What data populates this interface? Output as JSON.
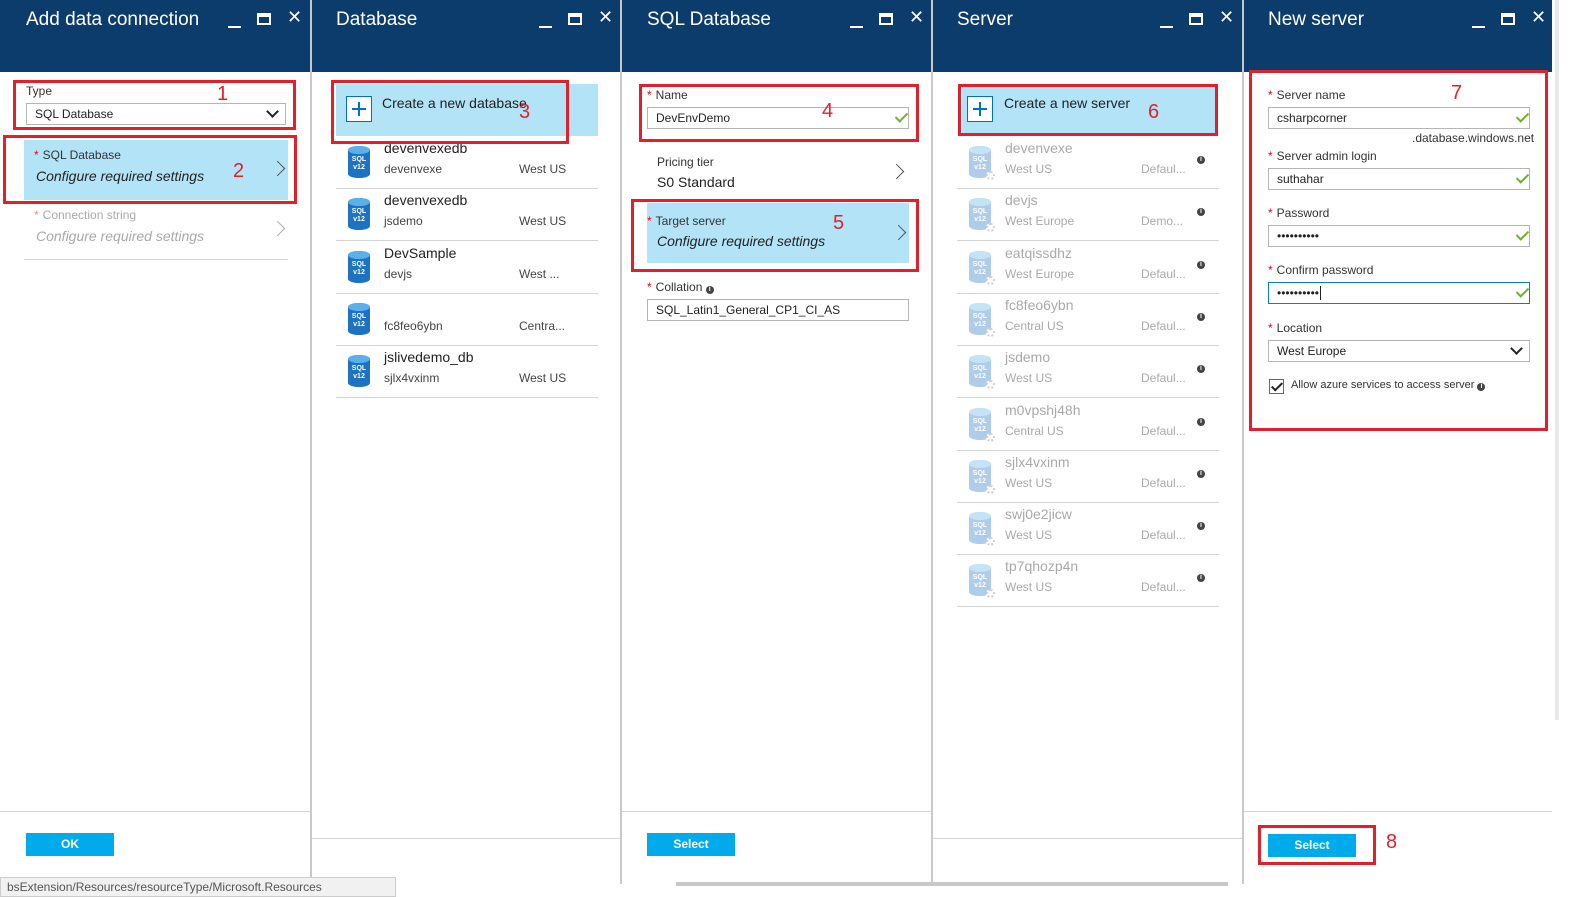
{
  "blades": {
    "add": {
      "title": "Add data connection",
      "type_label": "Type",
      "type_value": "SQL Database",
      "sql_db_label": "SQL Database",
      "sql_db_value": "Configure required settings",
      "conn_label": "Connection string",
      "conn_value": "Configure required settings",
      "ok_label": "OK"
    },
    "database": {
      "title": "Database",
      "create_label": "Create a new database",
      "items": [
        {
          "name": "devenvexedb",
          "server": "devenvexe",
          "location": "West US"
        },
        {
          "name": "devenvexedb",
          "server": "jsdemo",
          "location": "West US"
        },
        {
          "name": "DevSample",
          "server": "devjs",
          "location": "West ..."
        },
        {
          "name": "",
          "server": "fc8feo6ybn",
          "location": "Centra..."
        },
        {
          "name": "jslivedemo_db",
          "server": "sjlx4vxinm",
          "location": "West US"
        }
      ]
    },
    "sql": {
      "title": "SQL Database",
      "name_label": "Name",
      "name_value": "DevEnvDemo",
      "pricing_label": "Pricing tier",
      "pricing_value": "S0 Standard",
      "target_label": "Target server",
      "target_value": "Configure required settings",
      "collation_label": "Collation",
      "collation_value": "SQL_Latin1_General_CP1_CI_AS",
      "select_label": "Select"
    },
    "server": {
      "title": "Server",
      "create_label": "Create a new server",
      "items": [
        {
          "name": "devenvexe",
          "location": "West US",
          "extra": "Defaul..."
        },
        {
          "name": "devjs",
          "location": "West Europe",
          "extra": "Demo..."
        },
        {
          "name": "eatqissdhz",
          "location": "West Europe",
          "extra": "Defaul..."
        },
        {
          "name": "fc8feo6ybn",
          "location": "Central US",
          "extra": "Defaul..."
        },
        {
          "name": "jsdemo",
          "location": "West US",
          "extra": "Defaul..."
        },
        {
          "name": "m0vpshj48h",
          "location": "Central US",
          "extra": "Defaul..."
        },
        {
          "name": "sjlx4vxinm",
          "location": "West US",
          "extra": "Defaul..."
        },
        {
          "name": "swj0e2jicw",
          "location": "West US",
          "extra": "Defaul..."
        },
        {
          "name": "tp7qhozp4n",
          "location": "West US",
          "extra": "Defaul..."
        }
      ]
    },
    "new_server": {
      "title": "New server",
      "server_name_label": "Server name",
      "server_name_value": "csharpcorner",
      "server_name_suffix": ".database.windows.net",
      "admin_label": "Server admin login",
      "admin_value": "suthahar",
      "password_label": "Password",
      "password_value": "••••••••••",
      "confirm_label": "Confirm password",
      "confirm_value": "••••••••••",
      "location_label": "Location",
      "location_value": "West Europe",
      "allow_label": "Allow azure services to access server",
      "allow_checked": true,
      "select_label": "Select"
    }
  },
  "icon_text": "SQL v12",
  "annotations": [
    "1",
    "2",
    "3",
    "4",
    "5",
    "6",
    "7",
    "8"
  ],
  "status_bar": "bsExtension/Resources/resourceType/Microsoft.Resources",
  "colors": {
    "header": "#0c3c6b",
    "primary_button": "#00abec",
    "highlight": "#b3e3f7",
    "annotation": "#e0212c",
    "valid": "#6ab42d"
  }
}
